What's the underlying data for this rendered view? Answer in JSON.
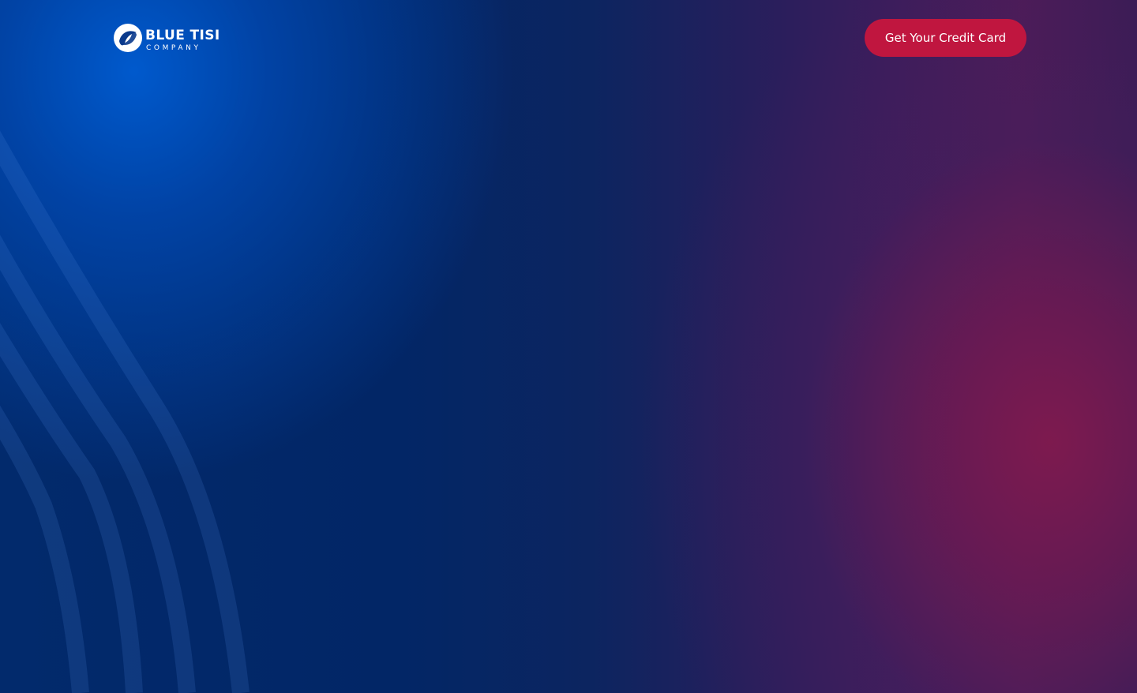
{
  "header": {
    "logo": {
      "icon": "brand-swirl-icon",
      "name": "BLUE TISI",
      "subtitle": "COMPANY"
    },
    "cta_label": "Get Your Credit Card"
  },
  "colors": {
    "cta_background": "#c0163f",
    "hero_blue": "#022766",
    "hero_magenta": "#7a1a4e",
    "text": "#ffffff"
  }
}
